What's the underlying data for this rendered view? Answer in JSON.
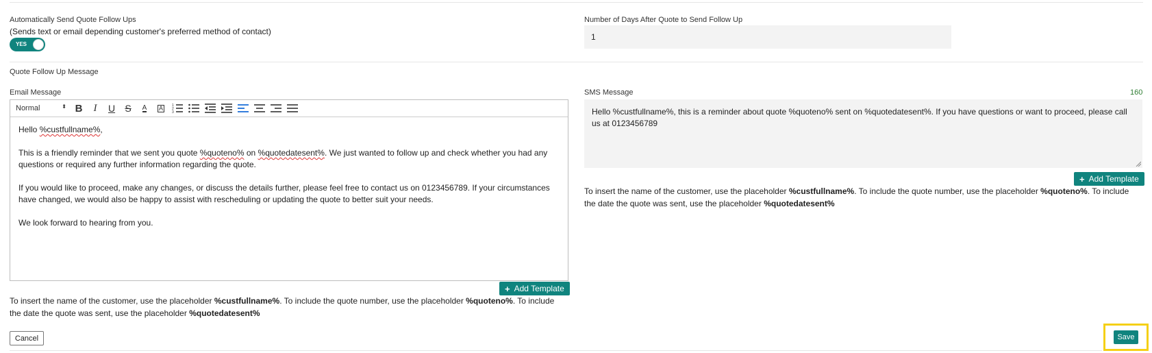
{
  "follow_ups": {
    "title": "Automatically Send Quote Follow Ups",
    "subtitle": "(Sends text or email depending customer's preferred method of contact)",
    "toggle_label": "YES",
    "toggle_on": true
  },
  "days": {
    "label": "Number of Days After Quote to Send Follow Up",
    "value": "1"
  },
  "section_title": "Quote Follow Up Message",
  "email": {
    "label": "Email Message",
    "toolbar": {
      "format_select": "Normal",
      "buttons": [
        "bold-icon",
        "italic-icon",
        "underline-icon",
        "strikethrough-icon",
        "font-color-icon",
        "background-color-icon",
        "ordered-list-icon",
        "bullet-list-icon",
        "outdent-icon",
        "indent-icon",
        "align-left-icon",
        "align-center-icon",
        "align-right-icon",
        "align-justify-icon"
      ]
    },
    "body": {
      "p1_a": "Hello ",
      "p1_ph": "%custfullname%",
      "p1_b": ",",
      "p2_a": "This is a friendly reminder that we sent you quote ",
      "p2_ph1": "%quoteno%",
      "p2_b": " on ",
      "p2_ph2": "%quotedatesent%",
      "p2_c": ". We just wanted to follow up and check whether you had any questions or required any further information regarding the quote.",
      "p3": "If you would like to proceed, make any changes, or discuss the details further, please feel free to contact us on 0123456789. If your circumstances have changed, we would also be happy to assist with rescheduling or updating the quote to better suit your needs.",
      "p4": "We look forward to hearing from you."
    },
    "add_template": "Add Template"
  },
  "sms": {
    "label": "SMS Message",
    "counter": "160",
    "value": "Hello %custfullname%, this is a reminder about quote %quoteno% sent on %quotedatesent%. If you have questions or want to proceed, please call us at 0123456789",
    "add_template": "Add Template"
  },
  "help": {
    "part1": "To insert the name of the customer, use the placeholder ",
    "ph1": "%custfullname%",
    "part2": ".  To include the quote number, use the placeholder ",
    "ph2": "%quoteno%",
    "part3": ".  To include the date the quote was sent, use the placeholder ",
    "ph3": "%quotedatesent%"
  },
  "actions": {
    "cancel": "Cancel",
    "save": "Save"
  },
  "colors": {
    "accent": "#10847e",
    "highlight": "#f5d016",
    "counter": "#2e7d32"
  }
}
